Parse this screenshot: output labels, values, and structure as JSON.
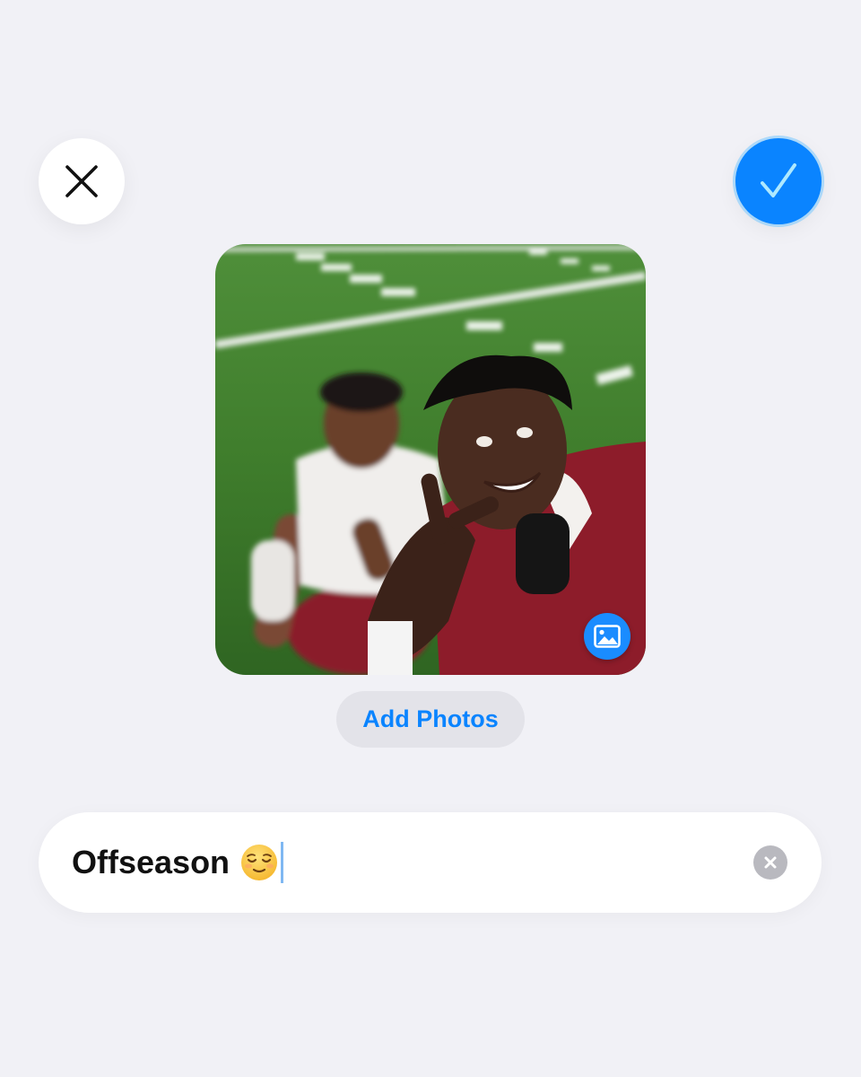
{
  "header": {
    "close_icon": "xmark-icon",
    "confirm_icon": "checkmark-icon",
    "accent_color": "#0a84ff"
  },
  "photo": {
    "description_icon": "photo-icon",
    "badge_color": "#1a8cff"
  },
  "add_photos": {
    "label": "Add Photos"
  },
  "name_field": {
    "value": "Offseason",
    "emoji_icon": "relieved-face-emoji-icon",
    "clear_icon": "clear-xmark-icon"
  }
}
